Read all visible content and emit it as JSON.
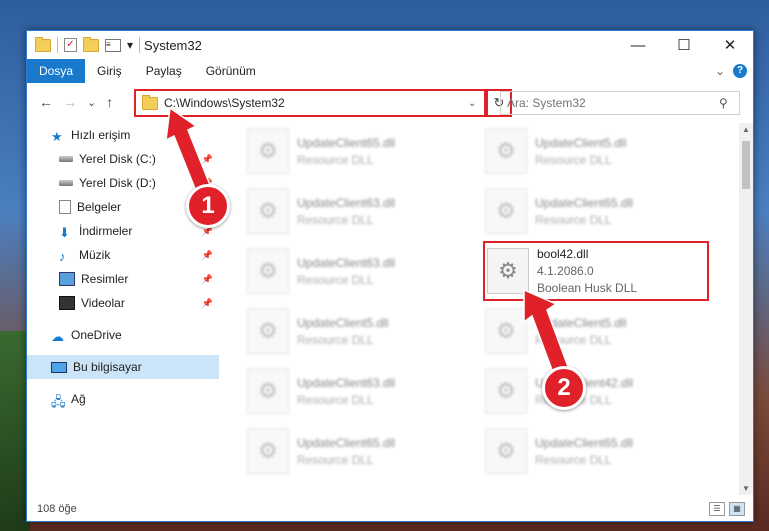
{
  "window": {
    "title": "System32",
    "controls": {
      "minimize": "—",
      "maximize": "☐",
      "close": "✕"
    }
  },
  "quick_access_toolbar": {
    "icons": [
      "folder-icon",
      "properties-check-icon",
      "new-folder-icon",
      "customize-icon"
    ],
    "dropdown": "▾"
  },
  "ribbon": {
    "tabs": [
      "Dosya",
      "Giriş",
      "Paylaş",
      "Görünüm"
    ],
    "active_tab": "Dosya",
    "expand": "⌄",
    "help": "?"
  },
  "nav": {
    "back": "←",
    "forward": "→",
    "recent": "⌄",
    "up": "↑"
  },
  "address": {
    "path": "C:\\Windows\\System32",
    "dropdown": "⌄",
    "refresh": "↻"
  },
  "search": {
    "placeholder": "Ara: System32",
    "icon": "⚲"
  },
  "sidebar": {
    "items": [
      {
        "label": "Hızlı erişim",
        "icon": "star-icon",
        "sub": false,
        "pinned": false
      },
      {
        "label": "Yerel Disk (C:)",
        "icon": "disk-icon",
        "sub": true,
        "pinned": true
      },
      {
        "label": "Yerel Disk (D:)",
        "icon": "disk-icon",
        "sub": true,
        "pinned": true
      },
      {
        "label": "Belgeler",
        "icon": "documents-icon",
        "sub": true,
        "pinned": true
      },
      {
        "label": "İndirmeler",
        "icon": "downloads-icon",
        "sub": true,
        "pinned": true
      },
      {
        "label": "Müzik",
        "icon": "music-icon",
        "sub": true,
        "pinned": true
      },
      {
        "label": "Resimler",
        "icon": "pictures-icon",
        "sub": true,
        "pinned": true
      },
      {
        "label": "Videolar",
        "icon": "videos-icon",
        "sub": true,
        "pinned": true
      },
      {
        "label": "OneDrive",
        "icon": "cloud-icon",
        "sub": false,
        "pinned": false
      },
      {
        "label": "Bu bilgisayar",
        "icon": "pc-icon",
        "sub": false,
        "pinned": false,
        "selected": true
      },
      {
        "label": "Ağ",
        "icon": "network-icon",
        "sub": false,
        "pinned": false
      }
    ]
  },
  "files": [
    {
      "name": "UpdateClient65.dll",
      "desc": "Resource DLL"
    },
    {
      "name": "UpdateClient5.dll",
      "desc": "Resource DLL"
    },
    {
      "name": "UpdateClient63.dll",
      "desc": "Resource DLL"
    },
    {
      "name": "UpdateClient65.dll",
      "desc": "Resource DLL"
    },
    {
      "name": "UpdateClient63.dll",
      "desc": "Resource DLL"
    },
    {
      "name": "bool42.dll",
      "version": "4.1.2086.0",
      "desc": "Boolean Husk DLL",
      "highlighted": true
    },
    {
      "name": "UpdateClient5.dll",
      "desc": "Resource DLL"
    },
    {
      "name": "UpdateClient5.dll",
      "desc": "Resource DLL"
    },
    {
      "name": "UpdateClient63.dll",
      "desc": "Resource DLL"
    },
    {
      "name": "UpdateClient42.dll",
      "desc": "Resource DLL"
    },
    {
      "name": "UpdateClient65.dll",
      "desc": "Resource DLL"
    },
    {
      "name": "UpdateClient65.dll",
      "desc": "Resource DLL"
    }
  ],
  "status": {
    "count": "108 öğe"
  },
  "annotations": {
    "step1": "1",
    "step2": "2",
    "color": "#e0212a"
  }
}
